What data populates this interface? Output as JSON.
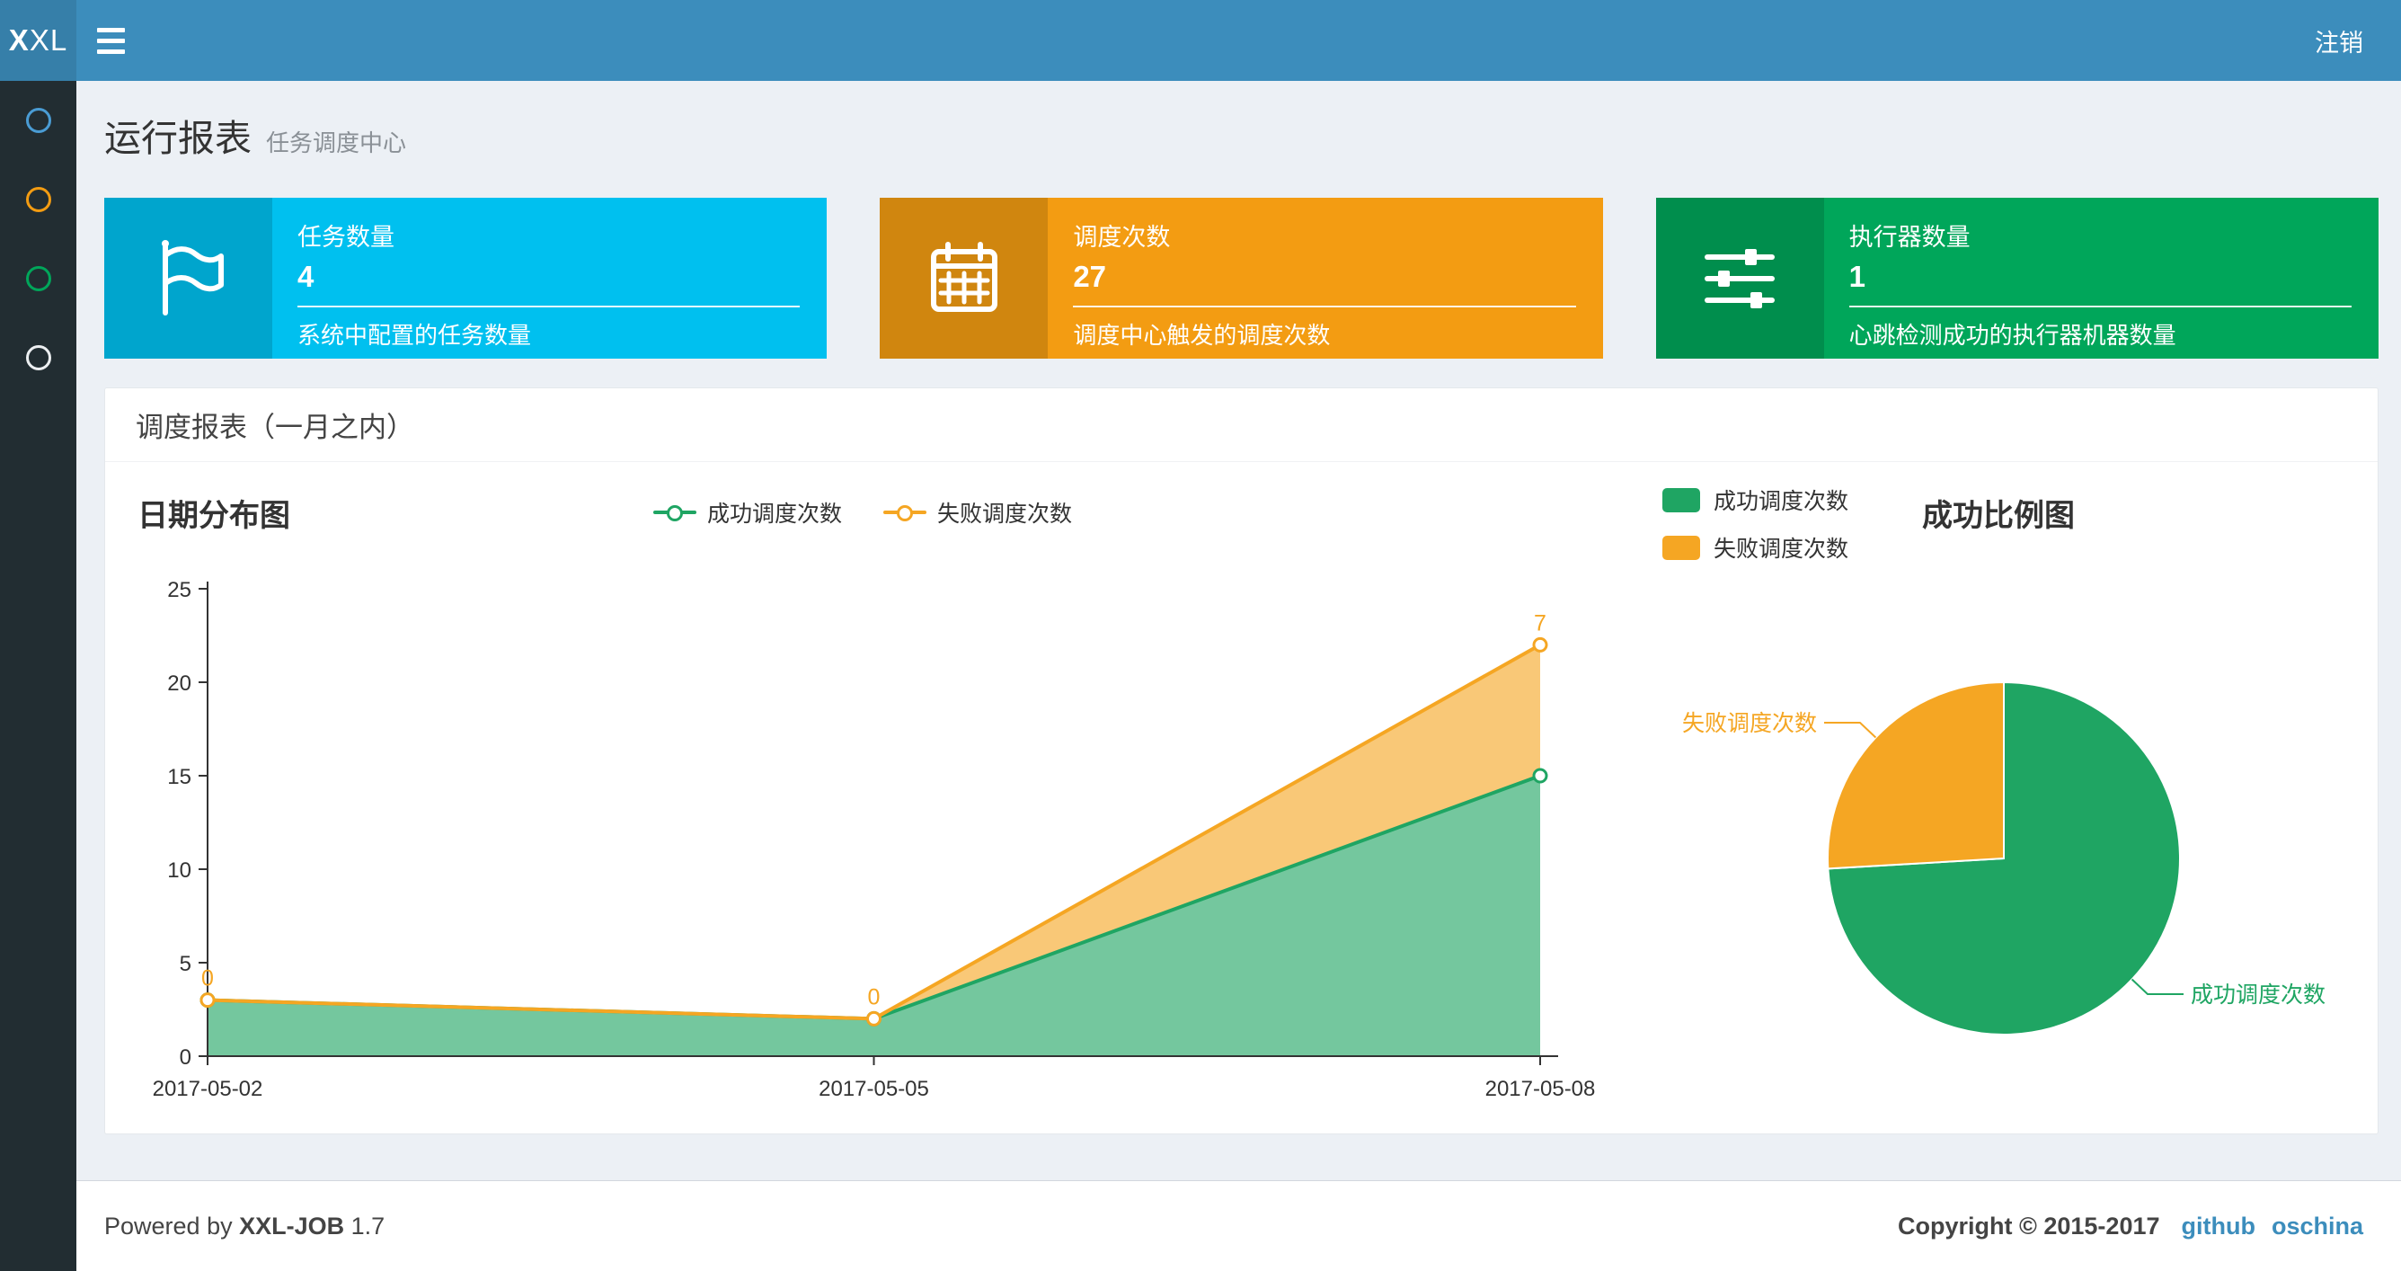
{
  "navbar": {
    "logo_bold": "X",
    "logo_rest": "XL",
    "logout_label": "注销"
  },
  "sidebar": {
    "items": [
      {
        "name": "menu-item-1",
        "color": "#4a9cd4"
      },
      {
        "name": "menu-item-2",
        "color": "#f39c12"
      },
      {
        "name": "menu-item-3",
        "color": "#00a65a"
      },
      {
        "name": "menu-item-4",
        "color": "#eceff1"
      }
    ]
  },
  "page": {
    "title": "运行报表",
    "subtitle": "任务调度中心"
  },
  "info_boxes": [
    {
      "label": "任务数量",
      "value": "4",
      "desc": "系统中配置的任务数量",
      "color": "#00c0ef",
      "icon": "flag-icon"
    },
    {
      "label": "调度次数",
      "value": "27",
      "desc": "调度中心触发的调度次数",
      "color": "#f39c12",
      "icon": "calendar-icon"
    },
    {
      "label": "执行器数量",
      "value": "1",
      "desc": "心跳检测成功的执行器机器数量",
      "color": "#00a65a",
      "icon": "sliders-icon"
    }
  ],
  "panel": {
    "title": "调度报表（一月之内）"
  },
  "chart_data": [
    {
      "type": "area",
      "title": "日期分布图",
      "x": [
        "2017-05-02",
        "2017-05-05",
        "2017-05-08"
      ],
      "series": [
        {
          "name": "成功调度次数",
          "values": [
            3,
            2,
            15
          ],
          "color": "#1fa563",
          "stacked": true,
          "point_labels": null
        },
        {
          "name": "失败调度次数",
          "values": [
            0,
            0,
            7
          ],
          "color": "#f5a623",
          "stacked": true,
          "point_labels": [
            "0",
            "0",
            "7"
          ]
        }
      ],
      "ylim": [
        0,
        25
      ],
      "yticks": [
        0,
        5,
        10,
        15,
        20,
        25
      ],
      "legend": [
        "成功调度次数",
        "失败调度次数"
      ],
      "legend_position": "top-center",
      "grid": false,
      "area_opacity": 0.62
    },
    {
      "type": "pie",
      "title": "成功比例图",
      "slices": [
        {
          "name": "成功调度次数",
          "value": 20,
          "color": "#1fa563"
        },
        {
          "name": "失败调度次数",
          "value": 7,
          "color": "#f5a623"
        }
      ],
      "legend": [
        "成功调度次数",
        "失败调度次数"
      ],
      "legend_position": "top-left"
    }
  ],
  "footer": {
    "powered_prefix": "Powered by",
    "product": "XXL-JOB",
    "version": "1.7",
    "copyright": "Copyright © 2015-2017",
    "links": [
      "github",
      "oschina"
    ],
    "link_color": "#3c8dbc"
  }
}
